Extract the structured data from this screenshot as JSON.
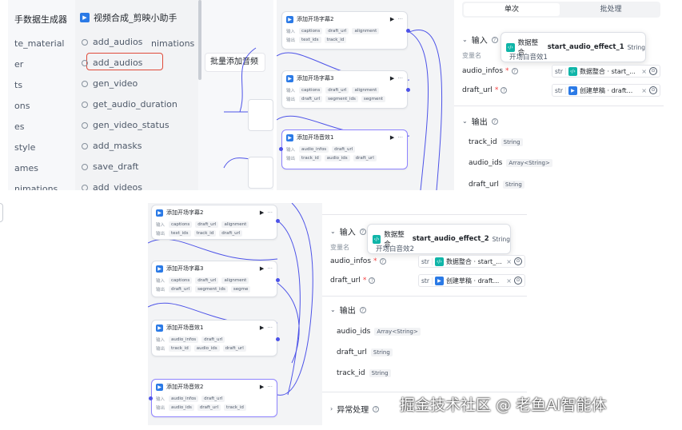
{
  "left_panel": {
    "sidebar_items": [
      "手数据生成器",
      "te_material",
      "er",
      "ts",
      "ons",
      "es",
      "style",
      "ames",
      "nimations"
    ],
    "plugin_name": "视频合成_剪映小助手",
    "plugin_items": [
      "add_audios",
      "add_audios",
      "gen_video",
      "get_audio_duration",
      "gen_video_status",
      "add_masks",
      "save_draft",
      "add_videos"
    ],
    "plugin_item_suffix": "nimations",
    "tooltip": "批量添加音频"
  },
  "canvas_top": {
    "nodes": [
      {
        "title": "添加开场字幕2",
        "in_tags": [
          "captions",
          "draft_url",
          "alignment"
        ],
        "out_tags": [
          "text_ids",
          "track_id"
        ]
      },
      {
        "title": "添加开场字幕3",
        "in_tags": [
          "captions",
          "draft_url",
          "alignment"
        ],
        "out_tags": [
          "draft_url",
          "segment_ids",
          "segment"
        ]
      },
      {
        "title": "添加开场音效1",
        "in_tags": [
          "audio_infos",
          "draft_url"
        ],
        "out_tags": [
          "track_id",
          "audio_ids",
          "draft_url"
        ]
      }
    ],
    "row_labels": {
      "in": "输入",
      "out": "输出"
    }
  },
  "canvas_bottom": {
    "nodes": [
      {
        "title": "添加开场字幕2",
        "in_tags": [
          "captions",
          "draft_url",
          "alignment"
        ],
        "out_tags": [
          "text_ids",
          "track_id",
          "draft_url"
        ]
      },
      {
        "title": "添加开场字幕3",
        "in_tags": [
          "captions",
          "draft_url",
          "alignment"
        ],
        "out_tags": [
          "draft_url",
          "segment_ids",
          "segme"
        ]
      },
      {
        "title": "添加开场音效1",
        "in_tags": [
          "audio_infos",
          "draft_url"
        ],
        "out_tags": [
          "track_id",
          "audio_ids",
          "draft_url"
        ]
      },
      {
        "title": "添加开场音效2",
        "in_tags": [
          "audio_infos",
          "draft_url"
        ],
        "out_tags": [
          "audio_ids",
          "draft_url",
          "track_id"
        ]
      }
    ],
    "row_labels": {
      "in": "输入",
      "out": "输出"
    }
  },
  "right_top": {
    "tabs": [
      "单次",
      "批处理"
    ],
    "input_section": "输入",
    "var_name_label": "变量名",
    "fields": [
      {
        "name": "audio_infos",
        "type": "str",
        "node": "数据整合 · start_...",
        "node_color": "#0fb5a8"
      },
      {
        "name": "draft_url",
        "type": "str",
        "node": "创建草稿 · draft...",
        "node_color": "#2b7ae6"
      }
    ],
    "tooltip": {
      "node": "数据整合",
      "var": "start_audio_effect_1",
      "type": "String",
      "desc": "开场白音效1"
    },
    "output_section": "输出",
    "outputs": [
      {
        "name": "track_id",
        "type": "String"
      },
      {
        "name": "audio_ids",
        "type": "Array<String>"
      },
      {
        "name": "draft_url",
        "type": "String"
      }
    ]
  },
  "right_bottom": {
    "input_section": "输入",
    "var_name_label": "变量名",
    "fields": [
      {
        "name": "audio_infos",
        "type": "str",
        "node": "数据整合 · start_...",
        "node_color": "#0fb5a8"
      },
      {
        "name": "draft_url",
        "type": "str",
        "node": "创建草稿 · draft...",
        "node_color": "#2b7ae6"
      }
    ],
    "tooltip": {
      "node": "数据整合",
      "var": "start_audio_effect_2",
      "type": "String",
      "desc": "开场白音效2"
    },
    "output_section": "输出",
    "outputs": [
      {
        "name": "audio_ids",
        "type": "Array<String>"
      },
      {
        "name": "draft_url",
        "type": "String"
      },
      {
        "name": "track_id",
        "type": "String"
      }
    ],
    "exception_section": "异常处理"
  },
  "watermark": "掘金技术社区 @ 老鱼AI智能体"
}
